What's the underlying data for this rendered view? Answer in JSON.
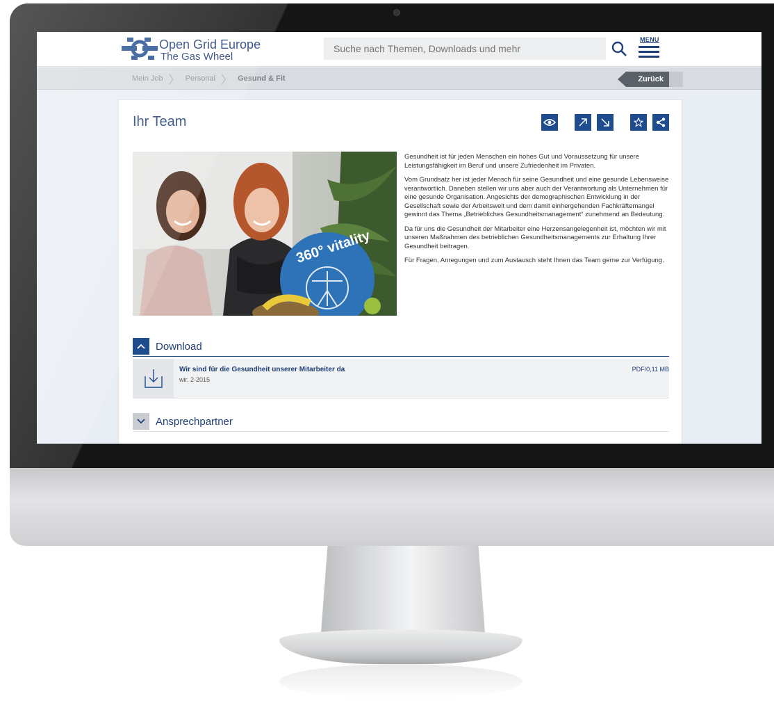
{
  "header": {
    "logo_title": "Open Grid Europe",
    "logo_subtitle": "The Gas Wheel",
    "search_placeholder": "Suche nach Themen, Downloads und mehr",
    "menu_label": "MENU"
  },
  "breadcrumb": {
    "items": [
      "Mein Job",
      "Personal",
      "Gesund & Fit"
    ],
    "back_label": "Zurück"
  },
  "page": {
    "title": "Ihr Team",
    "toolbar_icons": [
      "eye-icon",
      "expand-icon",
      "collapse-icon",
      "star-icon",
      "share-icon"
    ],
    "hero_badge": "360° vitality",
    "paragraphs": [
      "Gesundheit ist für jeden Menschen ein hohes Gut und Voraussetzung für unsere Leistungsfähigkeit im Beruf und unsere Zufriedenheit im Privaten.",
      "Vom Grundsatz her ist jeder Mensch für seine Gesundheit und eine gesunde Lebensweise verantwortlich. Daneben stellen wir uns aber auch der Verantwortung als Unternehmen für eine gesunde Organisation. Angesichts der demographischen Entwicklung in der Gesellschaft sowie der Arbeitswelt und dem damit einhergehenden Fachkräftemangel gewinnt das Thema „Betriebliches Gesundheitsmanagement“ zunehmend an Bedeutung.",
      "Da für uns die Gesundheit der Mitarbeiter eine Herzensangelegenheit ist, möchten wir mit unseren Maßnahmen des betrieblichen Gesundheitsmanagements zur Erhaltung Ihrer Gesundheit beitragen.",
      "Für Fragen, Anregungen und zum Austausch steht Ihnen das Team gerne zur Verfügung."
    ]
  },
  "download_section": {
    "label": "Download",
    "item": {
      "title": "Wir sind für die Gesundheit unserer Mitarbeiter da",
      "subtitle": "wir. 2-2015",
      "size": "PDF/0,11 MB"
    }
  },
  "contact_section": {
    "label": "Ansprechpartner"
  },
  "colors": {
    "brand_blue": "#1f4c8f",
    "text_blue": "#1f3f78",
    "screen_bg": "#e9eef5"
  }
}
